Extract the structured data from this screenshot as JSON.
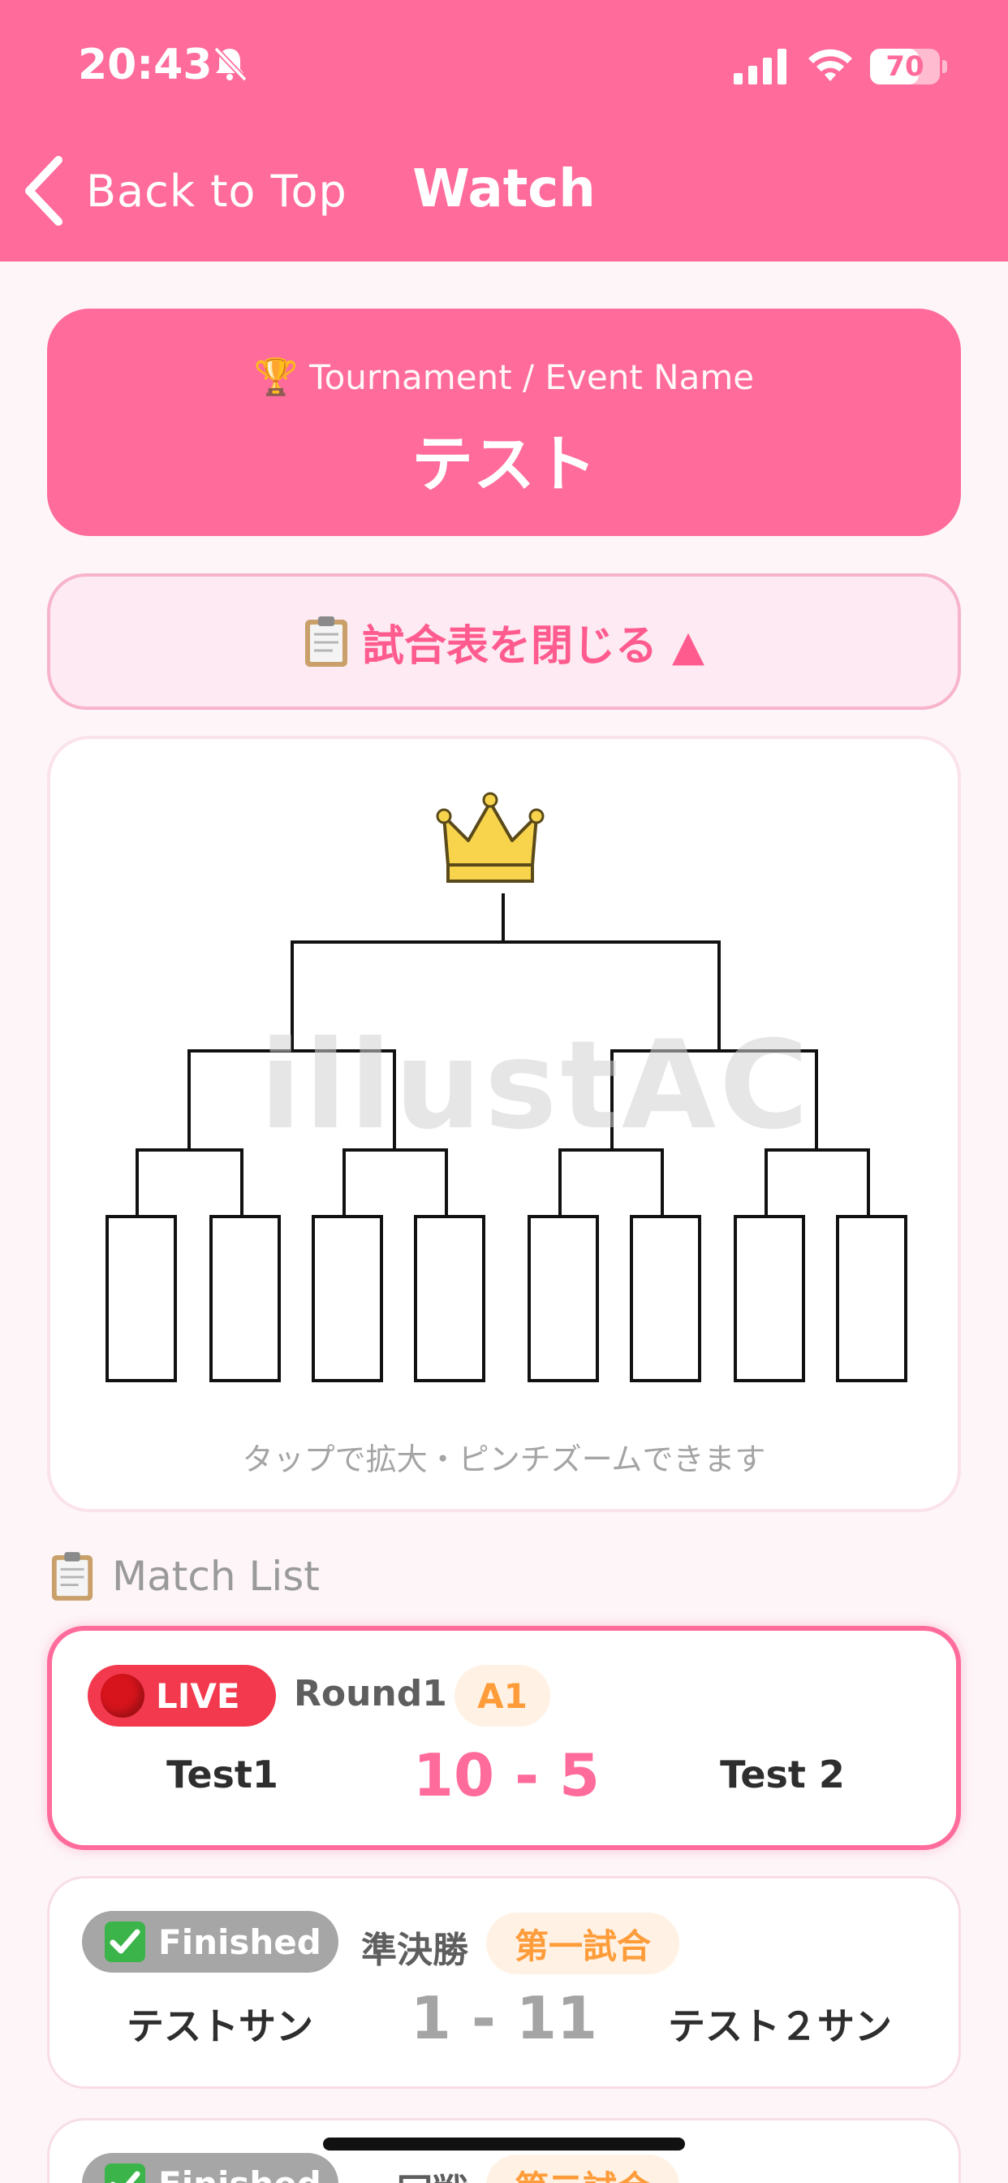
{
  "status_bar": {
    "time": "20:43",
    "battery_level": "70",
    "battery_fraction": 0.7
  },
  "nav": {
    "back_label": "Back to Top",
    "title": "Watch"
  },
  "event": {
    "label": "Tournament / Event Name",
    "trophy_icon": "🏆",
    "name": "テスト"
  },
  "bracket_toggle": {
    "label": "試合表を閉じる ▲"
  },
  "bracket": {
    "hint": "タップで拡大・ピンチズームできます",
    "crown_icon": "crown",
    "slot_count": 8,
    "watermark": "illustAC"
  },
  "match_list": {
    "title": "Match List",
    "matches": [
      {
        "status": "LIVE",
        "round": "Round1",
        "game": "A1",
        "team1": "Test1",
        "score": "10 - 5",
        "team2": "Test 2"
      },
      {
        "status": "Finished",
        "round": "準決勝",
        "game": "第一試合",
        "team1": "テストサン",
        "score": "1 - 11",
        "team2": "テスト２サン"
      },
      {
        "status": "Finished",
        "round": "一回戦",
        "game": "第二試合"
      }
    ]
  },
  "colors": {
    "primary": "#ff6b9a",
    "live": "#f2394e",
    "finished": "#a6a6a6",
    "game_badge_text": "#ff9c3a"
  }
}
